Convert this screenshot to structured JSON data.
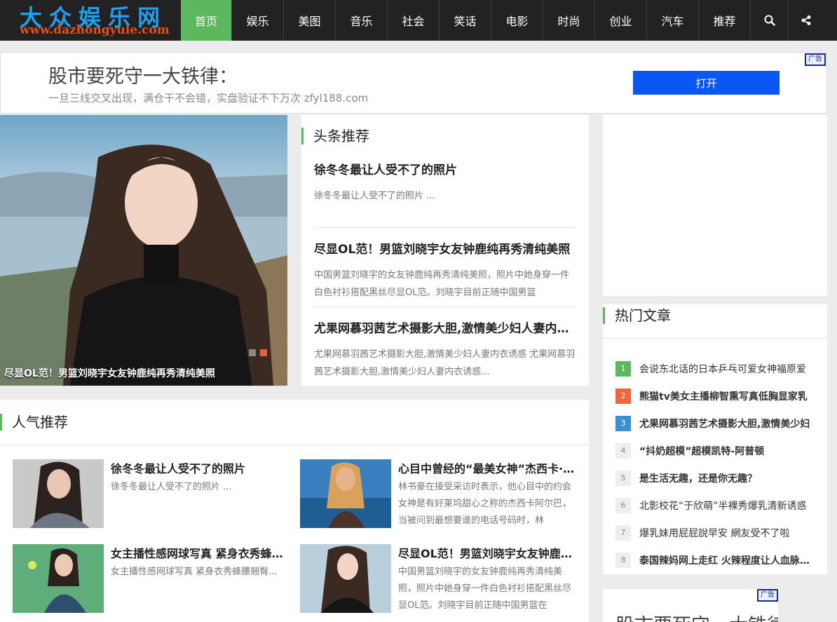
{
  "logo": {
    "title": "大众娱乐网",
    "url": "www.dazhongyule.com"
  },
  "nav": {
    "items": [
      "首页",
      "娱乐",
      "美图",
      "音乐",
      "社会",
      "笑话",
      "电影",
      "时尚",
      "创业",
      "汽车",
      "推荐"
    ],
    "search_icon": "search-icon",
    "share_icon": "share-icon"
  },
  "ad": {
    "title": "股市要死守一大铁律：",
    "desc": "一旦三线交叉出现，满仓干不会错，实盘验证不下万次 zfyl188.com",
    "button": "打开",
    "tag": "广告"
  },
  "slider": {
    "caption": "尽显OL范！男篮刘晓宇女友钟鹿纯再秀清纯美照"
  },
  "headline": {
    "title": "头条推荐",
    "items": [
      {
        "title": "徐冬冬最让人受不了的照片",
        "desc": "徐冬冬最让人受不了的照片 ..."
      },
      {
        "title": "尽显OL范！男篮刘晓宇女友钟鹿纯再秀清纯美照",
        "desc": "中国男篮刘晓宇的女友钟鹿纯再秀清纯美照，照片中她身穿一件白色衬衫搭配黑丝尽显OL范。刘晓宇目前正随中国男篮"
      },
      {
        "title": "尤果网慕羽茜艺术摄影大胆,激情美少妇人妻内衣诱惑",
        "desc": "尤果网慕羽茜艺术摄影大胆,激情美少妇人妻内衣诱惑 尤果网慕羽茜艺术摄影大胆,激情美少妇人妻内衣诱惑..."
      }
    ]
  },
  "hot": {
    "title": "热门文章",
    "items": [
      {
        "num": "1",
        "text": "会说东北话的日本乒乓可爱女神福原爱",
        "bold": false,
        "color": "#5cb85c"
      },
      {
        "num": "2",
        "text": "熊猫tv美女主播柳智熏写真低胸显家乳",
        "bold": true,
        "color": "#f0663c"
      },
      {
        "num": "3",
        "text": "尤果网慕羽茜艺术摄影大胆,激情美少妇",
        "bold": true,
        "color": "#3b8fd4"
      },
      {
        "num": "4",
        "text": "“抖奶超模”超模凯特-阿普顿",
        "bold": true,
        "color": ""
      },
      {
        "num": "5",
        "text": "是生活无趣，还是你无趣？",
        "bold": true,
        "color": ""
      },
      {
        "num": "6",
        "text": "北影校花“于欣萌”半裸秀爆乳清新诱惑",
        "bold": false,
        "color": ""
      },
      {
        "num": "7",
        "text": "爆乳妹用屁屁說早安 網友受不了啦",
        "bold": false,
        "color": ""
      },
      {
        "num": "8",
        "text": "泰国辣妈网上走红 火辣程度让人血脉喷张",
        "bold": true,
        "color": ""
      }
    ]
  },
  "right_ad": {
    "text": "股市要死守一大铁律",
    "tag": "广告"
  },
  "popular": {
    "title": "人气推荐",
    "items": [
      {
        "title": "徐冬冬最让人受不了的照片",
        "desc": "徐冬冬最让人受不了的照片 ..."
      },
      {
        "title": "心目中曾经的“最美女神”杰西卡·阿尔芭",
        "desc": "林书豪在接受采访时表示，他心目中的约会女神是有好莱坞甜心之称的杰西卡阿尔巴，当被问到最想要谁的电话号码时，林"
      },
      {
        "title": "女主播性感网球写真 紧身衣秀蜂腰翘臀",
        "desc": "女主播性感网球写真 紧身衣秀蜂腰翘臀..."
      },
      {
        "title": "尽显OL范！男篮刘晓宇女友钟鹿纯再秀清纯美照",
        "desc": "中国男篮刘晓宇的女友钟鹿纯再秀清纯美照，照片中她身穿一件白色衬衫搭配黑丝尽显OL范。刘晓宇目前正随中国男篮在"
      }
    ]
  }
}
